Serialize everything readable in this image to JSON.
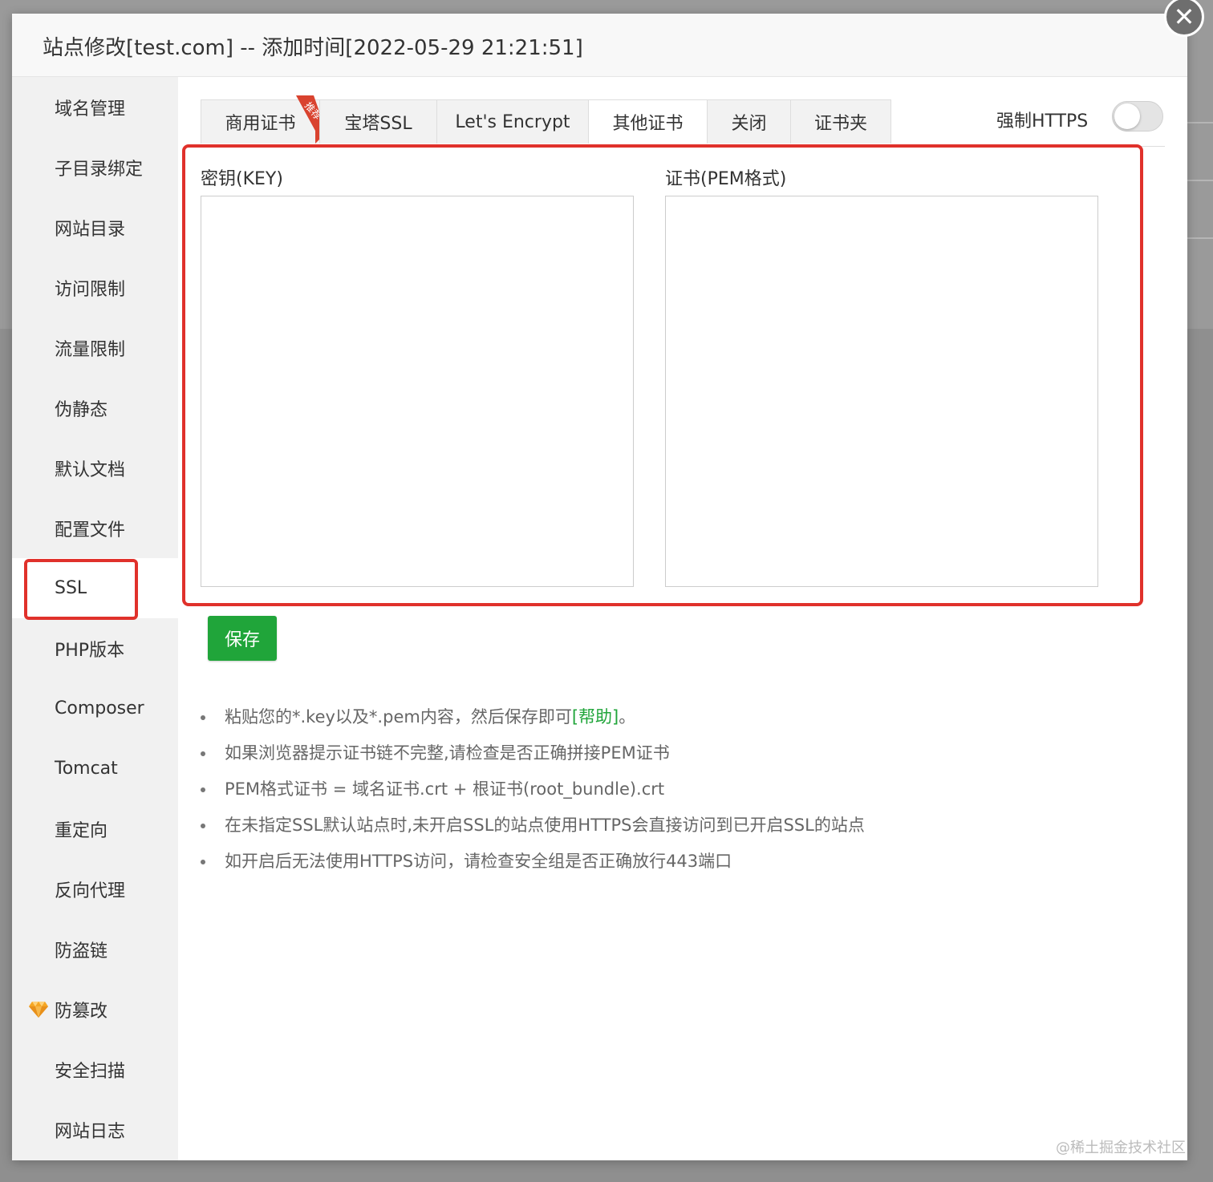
{
  "dialog": {
    "title": "站点修改[test.com] -- 添加时间[2022-05-29 21:21:51]",
    "close_symbol": "✕"
  },
  "sidebar": {
    "items": [
      {
        "label": "域名管理"
      },
      {
        "label": "子目录绑定"
      },
      {
        "label": "网站目录"
      },
      {
        "label": "访问限制"
      },
      {
        "label": "流量限制"
      },
      {
        "label": "伪静态"
      },
      {
        "label": "默认文档"
      },
      {
        "label": "配置文件"
      },
      {
        "label": "SSL",
        "active": true
      },
      {
        "label": "PHP版本"
      },
      {
        "label": "Composer"
      },
      {
        "label": "Tomcat"
      },
      {
        "label": "重定向"
      },
      {
        "label": "反向代理"
      },
      {
        "label": "防盗链"
      },
      {
        "label": "防篡改",
        "icon": "gem-icon"
      },
      {
        "label": "安全扫描"
      },
      {
        "label": "网站日志"
      }
    ]
  },
  "tabs": [
    {
      "label": "商用证书",
      "badge": "推荐"
    },
    {
      "label": "宝塔SSL"
    },
    {
      "label": "Let's Encrypt"
    },
    {
      "label": "其他证书",
      "active": true
    },
    {
      "label": "关闭"
    },
    {
      "label": "证书夹"
    }
  ],
  "force_https": {
    "label": "强制HTTPS",
    "enabled": false
  },
  "cert_form": {
    "key_label": "密钥(KEY)",
    "key_value": "",
    "pem_label": "证书(PEM格式)",
    "pem_value": ""
  },
  "save_label": "保存",
  "tips": {
    "tip1_prefix": "粘贴您的*.key以及*.pem内容，然后保存即可",
    "help_link": "[帮助]",
    "tip1_suffix": "。",
    "tip2": "如果浏览器提示证书链不完整,请检查是否正确拼接PEM证书",
    "tip3": "PEM格式证书 = 域名证书.crt + 根证书(root_bundle).crt",
    "tip4": "在未指定SSL默认站点时,未开启SSL的站点使用HTTPS会直接访问到已开启SSL的站点",
    "tip5": "如开启后无法使用HTTPS访问，请检查安全组是否正确放行443端口"
  },
  "watermark": "@稀土掘金技术社区",
  "colors": {
    "accent_green": "#20a53a",
    "highlight_red": "#e0312b",
    "ribbon_red": "#d9432f"
  }
}
